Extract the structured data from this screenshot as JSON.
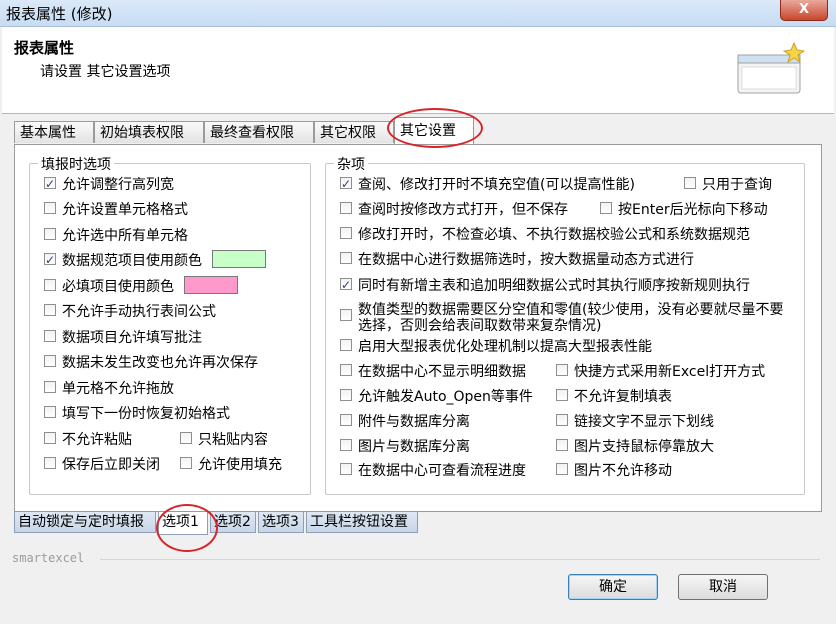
{
  "window": {
    "title": "报表属性 (修改)",
    "close_label": "X"
  },
  "header": {
    "title": "报表属性",
    "subtitle": "请设置 其它设置选项",
    "icon": "dialog-window-icon"
  },
  "tabs": [
    "基本属性",
    "初始填表权限",
    "最终查看权限",
    "其它权限",
    "其它设置"
  ],
  "active_tab": "其它设置",
  "left_group": {
    "legend": "填报时选项",
    "items": [
      {
        "label": "允许调整行高列宽",
        "checked": true
      },
      {
        "label": "允许设置单元格格式",
        "checked": false
      },
      {
        "label": "允许选中所有单元格",
        "checked": false
      },
      {
        "label": "数据规范项目使用颜色",
        "checked": true,
        "color": "#c8ffc8"
      },
      {
        "label": "必填项目使用颜色",
        "checked": false,
        "color": "#ff99cc"
      },
      {
        "label": "不允许手动执行表间公式",
        "checked": false
      },
      {
        "label": "数据项目允许填写批注",
        "checked": false
      },
      {
        "label": "数据未发生改变也允许再次保存",
        "checked": false
      },
      {
        "label": "单元格不允许拖放",
        "checked": false
      },
      {
        "label": "填写下一份时恢复初始格式",
        "checked": false
      },
      {
        "label": "不允许粘贴",
        "checked": false
      },
      {
        "label": "只粘贴内容",
        "checked": false
      },
      {
        "label": "保存后立即关闭",
        "checked": false
      },
      {
        "label": "允许使用填充",
        "checked": false
      }
    ]
  },
  "right_group": {
    "legend": "杂项",
    "items": [
      {
        "label": "查阅、修改打开时不填充空值(可以提高性能)",
        "checked": true
      },
      {
        "label": "只用于查询",
        "checked": false
      },
      {
        "label": "查阅时按修改方式打开，但不保存",
        "checked": false
      },
      {
        "label": "按Enter后光标向下移动",
        "checked": false
      },
      {
        "label": "修改打开时，不检查必填、不执行数据校验公式和系统数据规范",
        "checked": false
      },
      {
        "label": "在数据中心进行数据筛选时，按大数据量动态方式进行",
        "checked": false
      },
      {
        "label": "同时有新增主表和追加明细数据公式时其执行顺序按新规则执行",
        "checked": true
      },
      {
        "label": "数值类型的数据需要区分空值和零值(较少使用，没有必要就尽量不要选择，否则会给表间取数带来复杂情况)",
        "checked": false
      },
      {
        "label": "启用大型报表优化处理机制以提高大型报表性能",
        "checked": false
      },
      {
        "label": "在数据中心不显示明细数据",
        "checked": false
      },
      {
        "label": "快捷方式采用新Excel打开方式",
        "checked": false
      },
      {
        "label": "允许触发Auto_Open等事件",
        "checked": false
      },
      {
        "label": "不允许复制填表",
        "checked": false
      },
      {
        "label": "附件与数据库分离",
        "checked": false
      },
      {
        "label": "链接文字不显示下划线",
        "checked": false
      },
      {
        "label": "图片与数据库分离",
        "checked": false
      },
      {
        "label": "图片支持鼠标停靠放大",
        "checked": false
      },
      {
        "label": "在数据中心可查看流程进度",
        "checked": false
      },
      {
        "label": "图片不允许移动",
        "checked": false
      }
    ]
  },
  "bottom_tabs": [
    "自动锁定与定时填报",
    "选项1",
    "选项2",
    "选项3",
    "工具栏按钮设置"
  ],
  "active_bottom_tab": "选项1",
  "footer": {
    "brand": "smartexcel",
    "ok": "确定",
    "cancel": "取消"
  }
}
